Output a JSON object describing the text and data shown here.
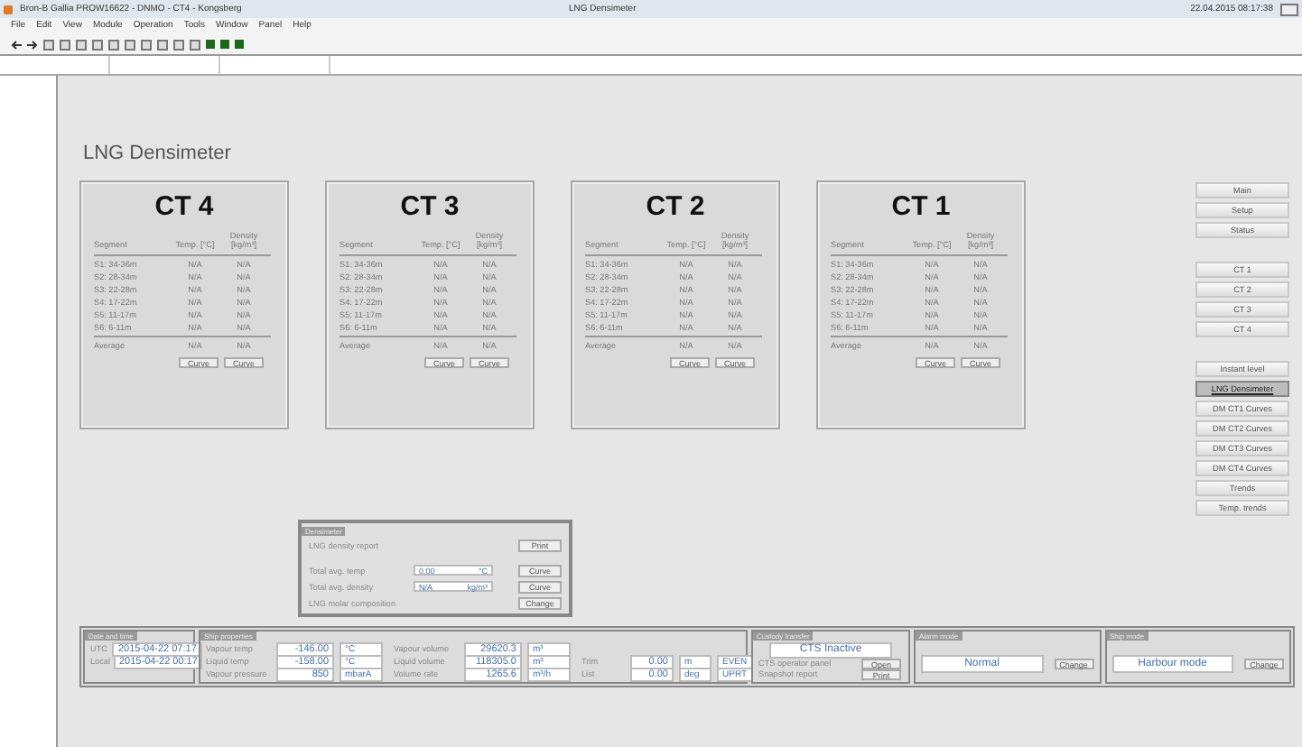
{
  "window": {
    "title": "Bron-B Gallia PROW16622 - DNMO - CT4 - Kongsberg",
    "center_title": "LNG Densimeter",
    "clock": "22.04.2015 08:17:38"
  },
  "menu": [
    "File",
    "Edit",
    "View",
    "Module",
    "Operation",
    "Tools",
    "Window",
    "Panel",
    "Help"
  ],
  "page_title": "LNG Densimeter",
  "tanks": [
    {
      "name": "CT 4",
      "columns": [
        "Segment",
        "Temp. [°C]",
        "Density [kg/m³]"
      ],
      "rows": [
        [
          "S1: 34-36m",
          "N/A",
          "N/A"
        ],
        [
          "S2: 28-34m",
          "N/A",
          "N/A"
        ],
        [
          "S3: 22-28m",
          "N/A",
          "N/A"
        ],
        [
          "S4: 17-22m",
          "N/A",
          "N/A"
        ],
        [
          "S5: 11-17m",
          "N/A",
          "N/A"
        ],
        [
          "S6: 6-11m",
          "N/A",
          "N/A"
        ]
      ],
      "average": [
        "Average",
        "N/A",
        "N/A"
      ],
      "buttons": [
        "Curve",
        "Curve"
      ]
    },
    {
      "name": "CT 3",
      "columns": [
        "Segment",
        "Temp. [°C]",
        "Density [kg/m³]"
      ],
      "rows": [
        [
          "S1: 34-36m",
          "N/A",
          "N/A"
        ],
        [
          "S2: 28-34m",
          "N/A",
          "N/A"
        ],
        [
          "S3: 22-28m",
          "N/A",
          "N/A"
        ],
        [
          "S4: 17-22m",
          "N/A",
          "N/A"
        ],
        [
          "S5: 11-17m",
          "N/A",
          "N/A"
        ],
        [
          "S6: 6-11m",
          "N/A",
          "N/A"
        ]
      ],
      "average": [
        "Average",
        "N/A",
        "N/A"
      ],
      "buttons": [
        "Curve",
        "Curve"
      ]
    },
    {
      "name": "CT 2",
      "columns": [
        "Segment",
        "Temp. [°C]",
        "Density [kg/m³]"
      ],
      "rows": [
        [
          "S1: 34-36m",
          "N/A",
          "N/A"
        ],
        [
          "S2: 28-34m",
          "N/A",
          "N/A"
        ],
        [
          "S3: 22-28m",
          "N/A",
          "N/A"
        ],
        [
          "S4: 17-22m",
          "N/A",
          "N/A"
        ],
        [
          "S5: 11-17m",
          "N/A",
          "N/A"
        ],
        [
          "S6: 6-11m",
          "N/A",
          "N/A"
        ]
      ],
      "average": [
        "Average",
        "N/A",
        "N/A"
      ],
      "buttons": [
        "Curve",
        "Curve"
      ]
    },
    {
      "name": "CT 1",
      "columns": [
        "Segment",
        "Temp. [°C]",
        "Density [kg/m³]"
      ],
      "rows": [
        [
          "S1: 34-36m",
          "N/A",
          "N/A"
        ],
        [
          "S2: 28-34m",
          "N/A",
          "N/A"
        ],
        [
          "S3: 22-28m",
          "N/A",
          "N/A"
        ],
        [
          "S4: 17-22m",
          "N/A",
          "N/A"
        ],
        [
          "S5: 11-17m",
          "N/A",
          "N/A"
        ],
        [
          "S6: 6-11m",
          "N/A",
          "N/A"
        ]
      ],
      "average": [
        "Average",
        "N/A",
        "N/A"
      ],
      "buttons": [
        "Curve",
        "Curve"
      ]
    }
  ],
  "sidebar": [
    [
      {
        "label": "Main",
        "selected": false
      },
      {
        "label": "Setup",
        "selected": false
      },
      {
        "label": "Status",
        "selected": false
      }
    ],
    [
      {
        "label": "CT 1",
        "selected": false
      },
      {
        "label": "CT 2",
        "selected": false
      },
      {
        "label": "CT 3",
        "selected": false
      },
      {
        "label": "CT 4",
        "selected": false
      }
    ],
    [
      {
        "label": "Instant level",
        "selected": false
      },
      {
        "label": "LNG Densimeter",
        "selected": true
      },
      {
        "label": "DM CT1 Curves",
        "selected": false
      },
      {
        "label": "DM CT2 Curves",
        "selected": false
      },
      {
        "label": "DM CT3 Curves",
        "selected": false
      },
      {
        "label": "DM CT4 Curves",
        "selected": false
      },
      {
        "label": "Trends",
        "selected": false
      },
      {
        "label": "Temp. trends",
        "selected": false
      }
    ]
  ],
  "density_panel": {
    "title": "Densimeter",
    "rows": [
      {
        "kind": "button",
        "label": "LNG density report",
        "button": "Print"
      },
      {
        "kind": "field",
        "label": "Total avg. temp",
        "value": "0.00",
        "unit": "°C",
        "button": "Curve"
      },
      {
        "kind": "field",
        "label": "Total avg. density",
        "value": "N/A",
        "unit": "kg/m³",
        "button": "Curve"
      },
      {
        "kind": "button",
        "label": "LNG molar composition",
        "button": "Change"
      }
    ]
  },
  "date_time": {
    "title": "Date and time",
    "rows": [
      {
        "label": "UTC",
        "value": "2015-04-22 07:17"
      },
      {
        "label": "Local",
        "value": "2015-04-22 00:17"
      }
    ]
  },
  "tank_properties": {
    "title": "Ship properties",
    "rows": [
      {
        "label": "Vapour temp",
        "value": "-146.00",
        "unit": "°C"
      },
      {
        "label": "Liquid temp",
        "value": "-158.00",
        "unit": "°C"
      },
      {
        "label": "Vapour pressure",
        "value": "850",
        "unit": "mbarA"
      },
      {
        "label": "Vapour volume",
        "value": "29620.3",
        "unit": "m³"
      },
      {
        "label": "Liquid volume",
        "value": "118305.0",
        "unit": "m³"
      },
      {
        "label": "Volume rate",
        "value": "1265.6",
        "unit": "m³/h"
      }
    ],
    "attitude": [
      {
        "label": "Trim",
        "value": "0.00",
        "unit": "m",
        "state": "EVEN"
      },
      {
        "label": "List",
        "value": "0.00",
        "unit": "deg",
        "state": "UPRT"
      }
    ]
  },
  "custody": {
    "title": "Custody transfer",
    "status": "CTS Inactive",
    "rows": [
      {
        "label": "CTS operator panel",
        "button": "Open"
      },
      {
        "label": "Snapshot report",
        "button": "Print"
      }
    ]
  },
  "modes": [
    {
      "title": "Alarm mode",
      "value": "Normal",
      "button": "Change"
    },
    {
      "title": "Ship mode",
      "value": "Harbour mode",
      "button": "Change"
    }
  ]
}
